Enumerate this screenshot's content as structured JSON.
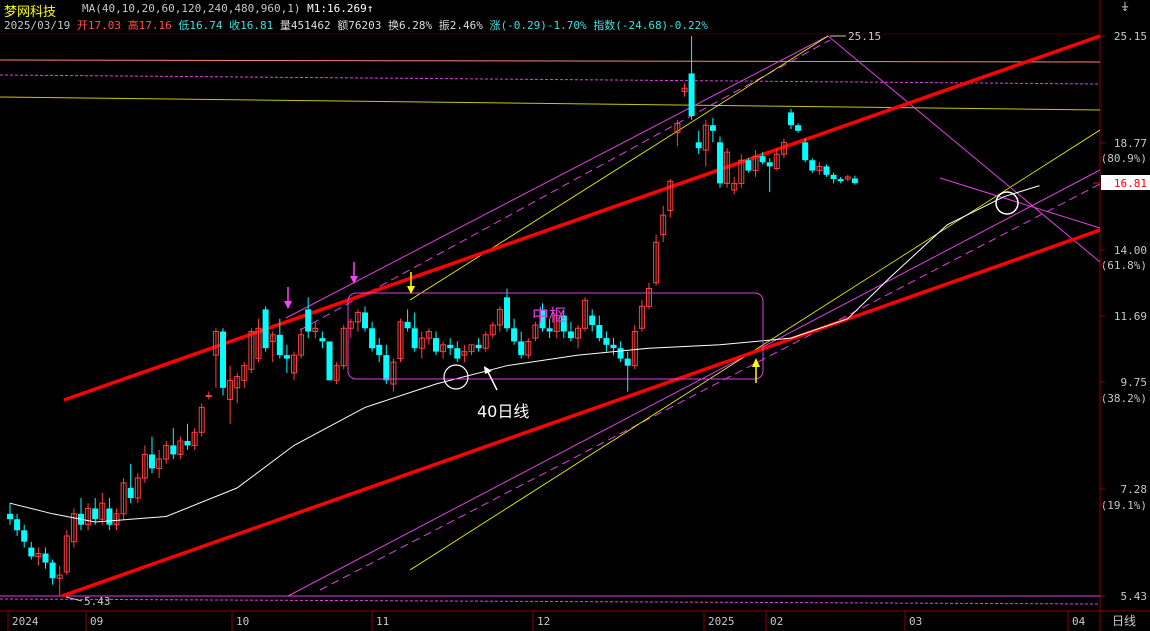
{
  "header": {
    "stock_name": "梦网科技",
    "ma_params": "MA(40,10,20,60,120,240,480,960,1)",
    "m1": "M1:16.269",
    "m1_arrow": "↑",
    "date": "2025/03/19",
    "open": "开17.03",
    "high": "高17.16",
    "low": "低16.74",
    "close": "收16.81",
    "volume": "量451462",
    "amount": "额76203",
    "turnover": "换6.28%",
    "amplitude": "振2.46%",
    "change": "涨(-0.29)-1.70%",
    "index": "指数(-24.68)-0.22%"
  },
  "corner_icon": "pin-icon",
  "corner_glyph": "⍖",
  "right_axis": {
    "labels": [
      "25.15",
      "18.77",
      "(80.9%)",
      "16.81",
      "14.00",
      "(61.8%)",
      "11.69",
      "9.75",
      "(38.2%)",
      "7.28",
      "(19.1%)",
      "5.43"
    ],
    "current_price": "16.81"
  },
  "x_axis": {
    "labels": [
      "2024",
      "09",
      "10",
      "11",
      "12",
      "2025",
      "02",
      "03",
      "04"
    ],
    "mode_label": "日线"
  },
  "annotations": {
    "zhongshu": "中枢",
    "ma40_label": "40日线",
    "high_label": "25.15",
    "low_label": "5.43"
  },
  "colors": {
    "up": "#ff4040",
    "down": "#00ffff",
    "trend": "#ff0000",
    "channel": "#e040e0",
    "guide": "#ffff00",
    "ma": "#ffffff",
    "background": "#000000"
  },
  "chart_data": {
    "type": "candlestick",
    "scale": "log",
    "ylim": [
      5.43,
      25.15
    ],
    "x_ticks": [
      "2024",
      "09",
      "10",
      "11",
      "12",
      "2025",
      "02",
      "03",
      "04"
    ],
    "series": [
      {
        "type": "candlestick",
        "values": [
          {
            "o": 6.8,
            "h": 7.0,
            "l": 6.6,
            "c": 6.7
          },
          {
            "o": 6.7,
            "h": 6.8,
            "l": 6.4,
            "c": 6.5
          },
          {
            "o": 6.5,
            "h": 6.6,
            "l": 6.2,
            "c": 6.3
          },
          {
            "o": 6.2,
            "h": 6.3,
            "l": 6.0,
            "c": 6.05
          },
          {
            "o": 6.05,
            "h": 6.2,
            "l": 5.9,
            "c": 6.1
          },
          {
            "o": 6.1,
            "h": 6.2,
            "l": 5.85,
            "c": 5.95
          },
          {
            "o": 5.95,
            "h": 6.0,
            "l": 5.6,
            "c": 5.7
          },
          {
            "o": 5.7,
            "h": 5.9,
            "l": 5.43,
            "c": 5.75
          },
          {
            "o": 5.8,
            "h": 6.5,
            "l": 5.75,
            "c": 6.4
          },
          {
            "o": 6.3,
            "h": 6.9,
            "l": 6.2,
            "c": 6.8
          },
          {
            "o": 6.8,
            "h": 7.1,
            "l": 6.5,
            "c": 6.6
          },
          {
            "o": 6.6,
            "h": 7.0,
            "l": 6.5,
            "c": 6.9
          },
          {
            "o": 6.9,
            "h": 7.1,
            "l": 6.6,
            "c": 6.7
          },
          {
            "o": 6.7,
            "h": 7.2,
            "l": 6.6,
            "c": 7.0
          },
          {
            "o": 6.9,
            "h": 7.1,
            "l": 6.5,
            "c": 6.6
          },
          {
            "o": 6.6,
            "h": 6.9,
            "l": 6.5,
            "c": 6.8
          },
          {
            "o": 6.8,
            "h": 7.5,
            "l": 6.7,
            "c": 7.4
          },
          {
            "o": 7.3,
            "h": 7.8,
            "l": 7.0,
            "c": 7.1
          },
          {
            "o": 7.1,
            "h": 7.6,
            "l": 7.0,
            "c": 7.5
          },
          {
            "o": 7.5,
            "h": 8.2,
            "l": 7.4,
            "c": 8.0
          },
          {
            "o": 8.0,
            "h": 8.4,
            "l": 7.6,
            "c": 7.7
          },
          {
            "o": 7.7,
            "h": 8.1,
            "l": 7.5,
            "c": 7.9
          },
          {
            "o": 7.9,
            "h": 8.3,
            "l": 7.8,
            "c": 8.2
          },
          {
            "o": 8.2,
            "h": 8.6,
            "l": 7.9,
            "c": 8.0
          },
          {
            "o": 8.0,
            "h": 8.4,
            "l": 7.9,
            "c": 8.3
          },
          {
            "o": 8.3,
            "h": 8.7,
            "l": 8.1,
            "c": 8.2
          },
          {
            "o": 8.2,
            "h": 8.6,
            "l": 8.1,
            "c": 8.5
          },
          {
            "o": 8.5,
            "h": 9.2,
            "l": 8.4,
            "c": 9.1
          },
          {
            "o": 9.4,
            "h": 9.5,
            "l": 9.3,
            "c": 9.4
          },
          {
            "o": 10.5,
            "h": 11.3,
            "l": 9.6,
            "c": 11.2
          },
          {
            "o": 11.2,
            "h": 11.3,
            "l": 9.4,
            "c": 9.6
          },
          {
            "o": 9.3,
            "h": 10.2,
            "l": 8.7,
            "c": 9.8
          },
          {
            "o": 9.6,
            "h": 10.0,
            "l": 9.2,
            "c": 9.9
          },
          {
            "o": 9.8,
            "h": 10.3,
            "l": 9.6,
            "c": 10.2
          },
          {
            "o": 10.1,
            "h": 11.3,
            "l": 10.0,
            "c": 11.2
          },
          {
            "o": 10.4,
            "h": 11.6,
            "l": 10.3,
            "c": 11.3
          },
          {
            "o": 11.9,
            "h": 12.0,
            "l": 10.6,
            "c": 10.7
          },
          {
            "o": 10.9,
            "h": 11.2,
            "l": 10.3,
            "c": 11.1
          },
          {
            "o": 11.1,
            "h": 11.6,
            "l": 10.4,
            "c": 10.5
          },
          {
            "o": 10.5,
            "h": 10.8,
            "l": 10.0,
            "c": 10.4
          },
          {
            "o": 10.0,
            "h": 10.6,
            "l": 9.8,
            "c": 10.5
          },
          {
            "o": 10.5,
            "h": 11.3,
            "l": 10.4,
            "c": 11.1
          },
          {
            "o": 11.9,
            "h": 12.3,
            "l": 11.0,
            "c": 11.2
          },
          {
            "o": 11.2,
            "h": 11.5,
            "l": 11.0,
            "c": 11.3
          },
          {
            "o": 11.0,
            "h": 11.2,
            "l": 10.7,
            "c": 10.9
          },
          {
            "o": 10.9,
            "h": 10.9,
            "l": 9.8,
            "c": 9.8
          },
          {
            "o": 9.8,
            "h": 10.3,
            "l": 9.7,
            "c": 10.2
          },
          {
            "o": 10.2,
            "h": 11.4,
            "l": 10.1,
            "c": 11.3
          },
          {
            "o": 11.3,
            "h": 11.6,
            "l": 11.0,
            "c": 11.5
          },
          {
            "o": 11.5,
            "h": 11.9,
            "l": 11.2,
            "c": 11.8
          },
          {
            "o": 11.8,
            "h": 12.0,
            "l": 11.2,
            "c": 11.3
          },
          {
            "o": 11.3,
            "h": 11.5,
            "l": 10.6,
            "c": 10.7
          },
          {
            "o": 10.8,
            "h": 11.0,
            "l": 10.3,
            "c": 10.5
          },
          {
            "o": 10.5,
            "h": 10.8,
            "l": 9.7,
            "c": 9.8
          },
          {
            "o": 9.7,
            "h": 10.4,
            "l": 9.5,
            "c": 10.3
          },
          {
            "o": 10.4,
            "h": 11.6,
            "l": 10.3,
            "c": 11.5
          },
          {
            "o": 11.5,
            "h": 11.9,
            "l": 11.2,
            "c": 11.3
          },
          {
            "o": 11.3,
            "h": 11.8,
            "l": 10.6,
            "c": 10.7
          },
          {
            "o": 10.7,
            "h": 11.2,
            "l": 10.4,
            "c": 11.0
          },
          {
            "o": 11.0,
            "h": 11.3,
            "l": 10.8,
            "c": 11.2
          },
          {
            "o": 11.0,
            "h": 11.2,
            "l": 10.5,
            "c": 10.6
          },
          {
            "o": 10.6,
            "h": 10.9,
            "l": 10.4,
            "c": 10.8
          },
          {
            "o": 10.8,
            "h": 11.0,
            "l": 10.5,
            "c": 10.7
          },
          {
            "o": 10.7,
            "h": 10.9,
            "l": 10.3,
            "c": 10.4
          },
          {
            "o": 10.5,
            "h": 10.8,
            "l": 10.3,
            "c": 10.6
          },
          {
            "o": 10.6,
            "h": 10.8,
            "l": 10.5,
            "c": 10.8
          },
          {
            "o": 10.8,
            "h": 11.0,
            "l": 10.6,
            "c": 10.7
          },
          {
            "o": 10.7,
            "h": 11.2,
            "l": 10.6,
            "c": 11.1
          },
          {
            "o": 11.1,
            "h": 11.5,
            "l": 11.0,
            "c": 11.4
          },
          {
            "o": 11.4,
            "h": 12.0,
            "l": 11.2,
            "c": 11.9
          },
          {
            "o": 12.3,
            "h": 12.6,
            "l": 11.2,
            "c": 11.3
          },
          {
            "o": 11.3,
            "h": 11.6,
            "l": 10.8,
            "c": 10.9
          },
          {
            "o": 10.9,
            "h": 11.2,
            "l": 10.4,
            "c": 10.5
          },
          {
            "o": 10.5,
            "h": 11.0,
            "l": 10.4,
            "c": 10.9
          },
          {
            "o": 11.0,
            "h": 11.5,
            "l": 10.9,
            "c": 11.4
          },
          {
            "o": 11.9,
            "h": 12.1,
            "l": 11.2,
            "c": 11.3
          },
          {
            "o": 11.3,
            "h": 11.6,
            "l": 11.0,
            "c": 11.2
          },
          {
            "o": 11.2,
            "h": 11.8,
            "l": 11.0,
            "c": 11.7
          },
          {
            "o": 11.7,
            "h": 11.9,
            "l": 11.0,
            "c": 11.2
          },
          {
            "o": 11.2,
            "h": 11.5,
            "l": 10.9,
            "c": 11.0
          },
          {
            "o": 11.0,
            "h": 11.4,
            "l": 10.7,
            "c": 11.3
          },
          {
            "o": 11.3,
            "h": 12.3,
            "l": 11.2,
            "c": 12.2
          },
          {
            "o": 11.7,
            "h": 11.9,
            "l": 11.2,
            "c": 11.4
          },
          {
            "o": 11.4,
            "h": 11.7,
            "l": 10.9,
            "c": 11.0
          },
          {
            "o": 11.0,
            "h": 11.2,
            "l": 10.6,
            "c": 10.8
          },
          {
            "o": 10.8,
            "h": 11.0,
            "l": 10.5,
            "c": 10.7
          },
          {
            "o": 10.7,
            "h": 10.9,
            "l": 10.3,
            "c": 10.4
          },
          {
            "o": 10.4,
            "h": 10.6,
            "l": 9.5,
            "c": 10.2
          },
          {
            "o": 10.2,
            "h": 11.4,
            "l": 10.1,
            "c": 11.2
          },
          {
            "o": 11.3,
            "h": 12.2,
            "l": 11.2,
            "c": 12.0
          },
          {
            "o": 12.0,
            "h": 12.8,
            "l": 11.9,
            "c": 12.6
          },
          {
            "o": 12.8,
            "h": 14.6,
            "l": 12.7,
            "c": 14.3
          },
          {
            "o": 14.6,
            "h": 15.8,
            "l": 14.3,
            "c": 15.4
          },
          {
            "o": 15.6,
            "h": 17.0,
            "l": 15.3,
            "c": 16.9
          },
          {
            "o": 19.3,
            "h": 20.0,
            "l": 18.6,
            "c": 19.8
          },
          {
            "o": 21.6,
            "h": 22.1,
            "l": 21.3,
            "c": 21.8
          },
          {
            "o": 22.7,
            "h": 25.15,
            "l": 20.0,
            "c": 20.2
          },
          {
            "o": 18.8,
            "h": 19.4,
            "l": 18.2,
            "c": 18.5
          },
          {
            "o": 18.4,
            "h": 20.0,
            "l": 17.6,
            "c": 19.7
          },
          {
            "o": 19.7,
            "h": 20.1,
            "l": 18.8,
            "c": 19.4
          },
          {
            "o": 18.8,
            "h": 19.1,
            "l": 16.6,
            "c": 16.8
          },
          {
            "o": 16.8,
            "h": 18.5,
            "l": 16.6,
            "c": 18.3
          },
          {
            "o": 16.5,
            "h": 17.1,
            "l": 16.3,
            "c": 16.8
          },
          {
            "o": 16.8,
            "h": 18.2,
            "l": 16.6,
            "c": 17.9
          },
          {
            "o": 17.9,
            "h": 18.0,
            "l": 17.3,
            "c": 17.4
          },
          {
            "o": 17.4,
            "h": 18.4,
            "l": 17.1,
            "c": 18.1
          },
          {
            "o": 18.1,
            "h": 18.3,
            "l": 17.7,
            "c": 17.8
          },
          {
            "o": 17.8,
            "h": 18.0,
            "l": 16.4,
            "c": 17.6
          },
          {
            "o": 17.5,
            "h": 18.5,
            "l": 17.4,
            "c": 18.2
          },
          {
            "o": 18.2,
            "h": 19.0,
            "l": 18.0,
            "c": 18.8
          },
          {
            "o": 20.4,
            "h": 20.6,
            "l": 19.5,
            "c": 19.7
          },
          {
            "o": 19.7,
            "h": 19.8,
            "l": 19.3,
            "c": 19.4
          },
          {
            "o": 18.8,
            "h": 19.0,
            "l": 17.8,
            "c": 17.9
          },
          {
            "o": 17.9,
            "h": 18.0,
            "l": 17.3,
            "c": 17.4
          },
          {
            "o": 17.4,
            "h": 17.8,
            "l": 17.2,
            "c": 17.6
          },
          {
            "o": 17.6,
            "h": 17.7,
            "l": 17.1,
            "c": 17.2
          },
          {
            "o": 17.2,
            "h": 17.3,
            "l": 16.8,
            "c": 17.0
          },
          {
            "o": 17.0,
            "h": 17.1,
            "l": 16.8,
            "c": 16.9
          },
          {
            "o": 17.0,
            "h": 17.2,
            "l": 16.9,
            "c": 17.1
          },
          {
            "o": 17.03,
            "h": 17.16,
            "l": 16.74,
            "c": 16.81
          }
        ]
      },
      {
        "name": "MA(40)",
        "type": "line",
        "values": [
          [
            0,
            7.0
          ],
          [
            6,
            6.8
          ],
          [
            12,
            6.65
          ],
          [
            22,
            6.75
          ],
          [
            32,
            7.3
          ],
          [
            40,
            8.2
          ],
          [
            50,
            9.1
          ],
          [
            60,
            9.7
          ],
          [
            70,
            10.2
          ],
          [
            80,
            10.5
          ],
          [
            90,
            10.7
          ],
          [
            100,
            10.8
          ],
          [
            110,
            11.0
          ],
          [
            118,
            11.6
          ],
          [
            124,
            13.0
          ],
          [
            132,
            15.0
          ],
          [
            140,
            16.2
          ],
          [
            145,
            16.7
          ]
        ]
      }
    ]
  }
}
